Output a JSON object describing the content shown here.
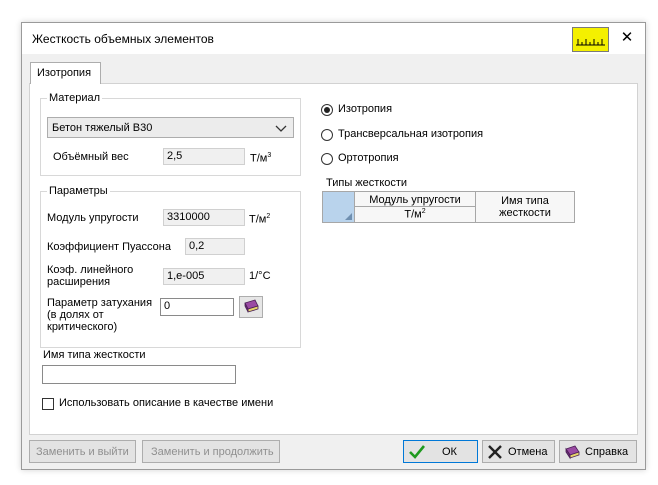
{
  "window": {
    "title": "Жесткость объемных элементов",
    "close_glyph": "✕"
  },
  "tabs": [
    {
      "label": "Изотропия"
    }
  ],
  "material_group": {
    "legend": "Материал",
    "material_value": "Бетон тяжелый В30",
    "weight_label": "Объёмный вес",
    "weight_value": "2,5",
    "weight_unit": "Т/м",
    "weight_unit_sup": "3"
  },
  "params_group": {
    "legend": "Параметры",
    "modulus_label": "Модуль упругости",
    "modulus_value": "3310000",
    "modulus_unit": "Т/м",
    "modulus_unit_sup": "2",
    "poisson_label": "Коэффициент Пуассона",
    "poisson_value": "0,2",
    "thermal_label_1": "Коэф. линейного",
    "thermal_label_2": "расширения",
    "thermal_value": "1,e-005",
    "thermal_unit": "1/°C",
    "damping_label_1": "Параметр затухания",
    "damping_label_2": "(в долях от",
    "damping_label_3": "критического)",
    "damping_value": "0"
  },
  "stiffness_name": {
    "label": "Имя типа жесткости",
    "value": ""
  },
  "use_description": {
    "label": "Использовать описание в качестве имени",
    "checked": false
  },
  "radios": [
    {
      "label": "Изотропия",
      "selected": true
    },
    {
      "label": "Трансверсальная изотропия",
      "selected": false
    },
    {
      "label": "Ортотропия",
      "selected": false
    }
  ],
  "stiffness_types": {
    "label": "Типы жесткости",
    "col1_line1": "Модуль упругости",
    "col1_line2": "Т/м",
    "col1_sup": "2",
    "col2_line1": "Имя типа",
    "col2_line2": "жесткости"
  },
  "footer": {
    "replace_exit": "Заменить и выйти",
    "replace_continue": "Заменить и продолжить",
    "ok": "ОК",
    "cancel": "Отмена",
    "help": "Справка"
  },
  "icons": [
    "ruler-icon",
    "close-icon",
    "chevron-down-icon",
    "book-icon",
    "checkmark-icon",
    "cross-icon",
    "help-book-icon"
  ],
  "colors": {
    "ok_check": "#1f9a1f",
    "cancel_cross": "#222222",
    "ruler_bg": "#f4f000",
    "grid_corner": "#b9d3ec"
  }
}
